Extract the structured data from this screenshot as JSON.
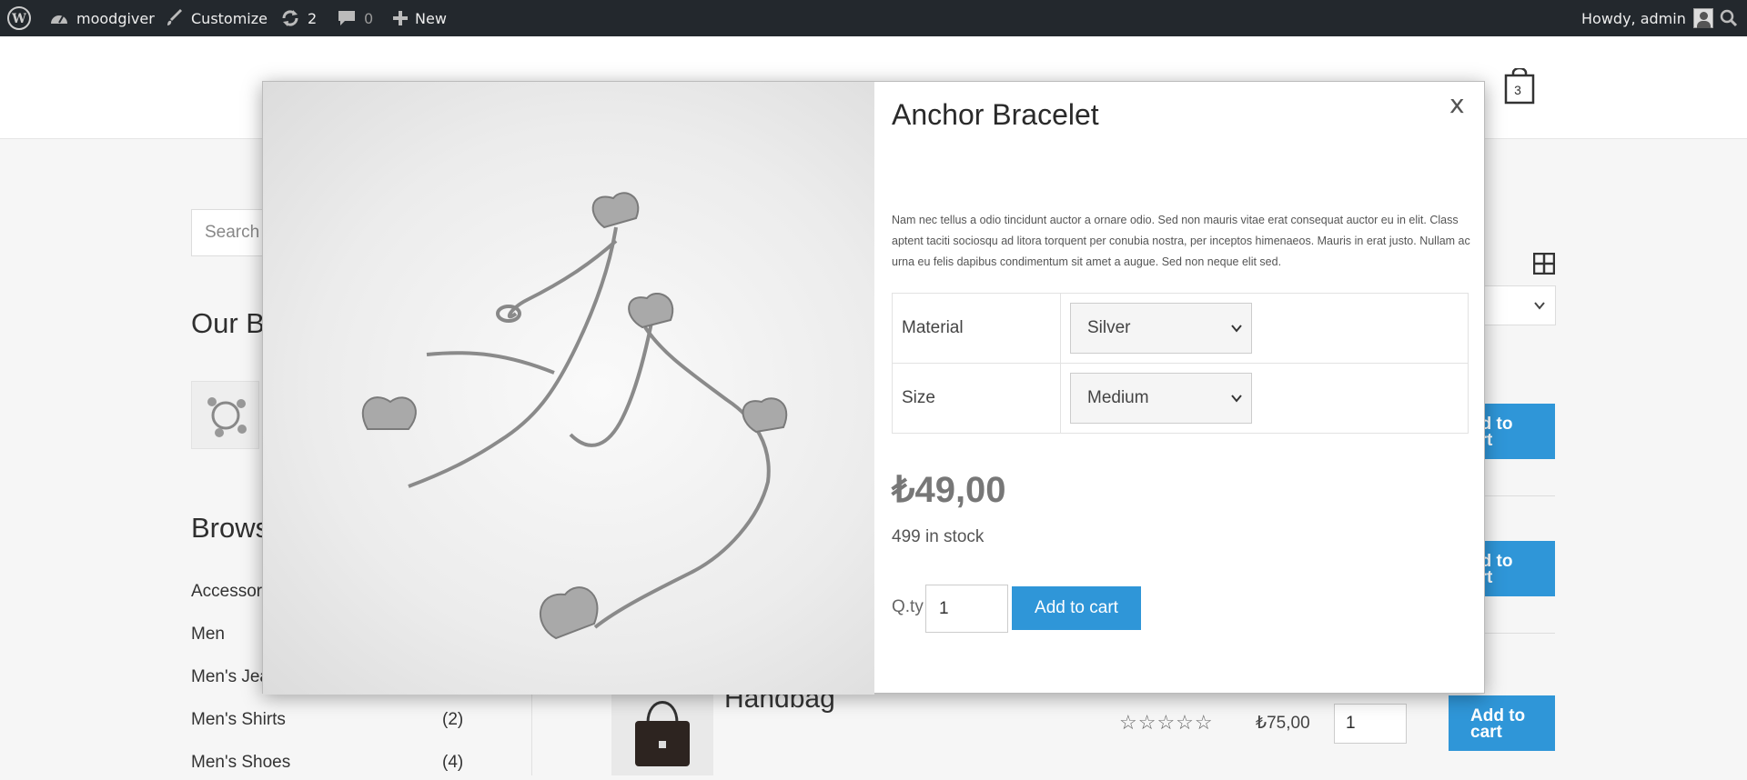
{
  "adminbar": {
    "site_name": "moodgiver",
    "customize": "Customize",
    "updates": "2",
    "comments": "0",
    "new": "New",
    "howdy": "Howdy, admin"
  },
  "header": {
    "cart_count": "3"
  },
  "page": {
    "search_placeholder": "Search p",
    "widget_brands_title": "Our B",
    "widget_browse_title": "Brows",
    "categories": [
      {
        "label": "Accessori",
        "count": ""
      },
      {
        "label": "Men",
        "count": ""
      },
      {
        "label": "Men's Jea",
        "count": ""
      },
      {
        "label": "Men's Shirts",
        "count": "(2)"
      },
      {
        "label": "Men's Shoes",
        "count": "(4)"
      }
    ],
    "add_to_cart_labels": [
      "dd to\nart",
      "dd to\nart",
      "Add to\ncart"
    ],
    "product": {
      "title": "Handbag",
      "stars": "☆☆☆☆☆",
      "price": "₺75,00",
      "qty": "1"
    }
  },
  "modal": {
    "close": "x",
    "title": "Anchor Bracelet",
    "description": "Nam nec tellus a odio tincidunt auctor a ornare odio. Sed non mauris vitae erat consequat auctor eu in elit. Class aptent taciti sociosqu ad litora torquent per conubia nostra, per inceptos himenaeos. Mauris in erat justo. Nullam ac urna eu felis dapibus condimentum sit amet a augue. Sed non neque elit sed.",
    "attributes": [
      {
        "label": "Material",
        "value": "Silver"
      },
      {
        "label": "Size",
        "value": "Medium"
      }
    ],
    "price": "₺49,00",
    "stock": "499 in stock",
    "qty_label": "Q.ty",
    "qty_value": "1",
    "add_to_cart": "Add to cart"
  },
  "colors": {
    "adminbar": "#23282d",
    "accent": "#2f96d8"
  }
}
